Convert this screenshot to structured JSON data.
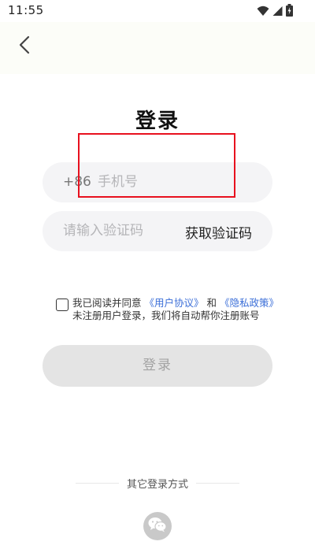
{
  "status_bar": {
    "time": "11:55",
    "icons": [
      "wifi-icon",
      "signal-icon",
      "battery-icon"
    ]
  },
  "header": {
    "back_icon": "chevron-left-icon"
  },
  "page": {
    "title": "登录"
  },
  "phone_field": {
    "country_code": "+86",
    "value": "",
    "placeholder": "手机号"
  },
  "code_field": {
    "value": "",
    "placeholder": "请输入验证码",
    "get_code_label": "获取验证码"
  },
  "agreement": {
    "checked": false,
    "prefix": "我已阅读并同意 ",
    "user_agreement": "《用户协议》",
    "and": " 和 ",
    "privacy_policy": "《隐私政策》",
    "note": "未注册用户登录，我们将自动帮你注册账号"
  },
  "login_button": {
    "label": "登录"
  },
  "other_login": {
    "label": "其它登录方式",
    "wechat_icon": "wechat-icon"
  },
  "colors": {
    "link": "#3c6fd8",
    "highlight": "#e8101e",
    "button_disabled_bg": "#e4e4e4",
    "button_disabled_text": "#a3a3a3",
    "field_bg": "#f4f4f6"
  }
}
